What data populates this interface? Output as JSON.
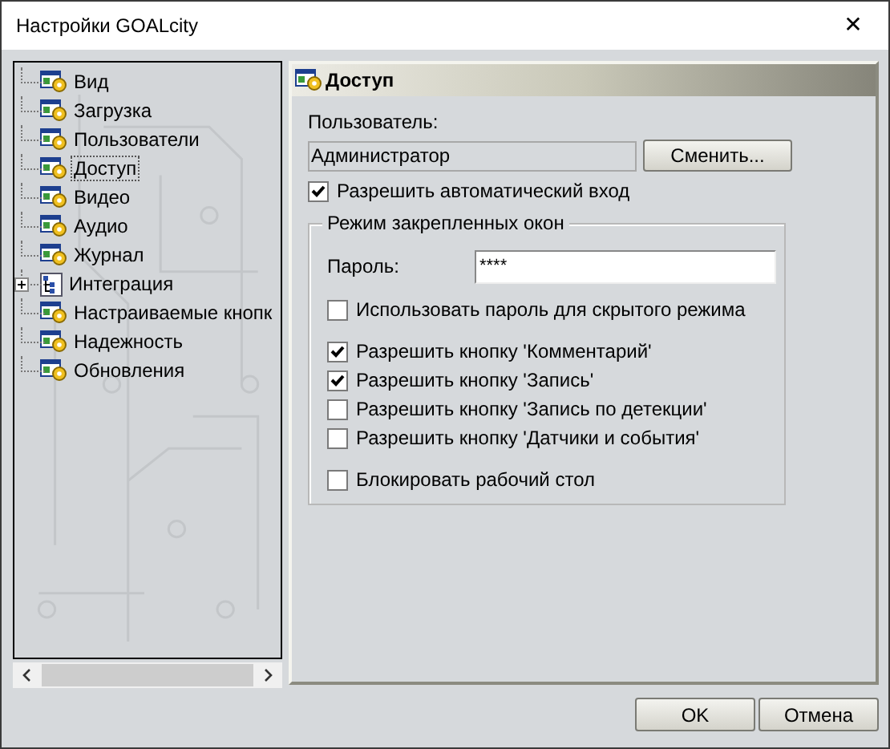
{
  "window": {
    "title": "Настройки GOALcity",
    "close": "✕"
  },
  "tree": {
    "items": [
      {
        "label": "Вид",
        "kind": "page",
        "selected": false
      },
      {
        "label": "Загрузка",
        "kind": "page",
        "selected": false
      },
      {
        "label": "Пользователи",
        "kind": "page",
        "selected": false
      },
      {
        "label": "Доступ",
        "kind": "page",
        "selected": true
      },
      {
        "label": "Видео",
        "kind": "page",
        "selected": false
      },
      {
        "label": "Аудио",
        "kind": "page",
        "selected": false
      },
      {
        "label": "Журнал",
        "kind": "page",
        "selected": false
      },
      {
        "label": "Интеграция",
        "kind": "group",
        "selected": false,
        "expanded": false
      },
      {
        "label": "Настраиваемые кнопк",
        "kind": "page",
        "selected": false
      },
      {
        "label": "Надежность",
        "kind": "page",
        "selected": false
      },
      {
        "label": "Обновления",
        "kind": "page",
        "selected": false
      }
    ]
  },
  "panel": {
    "title": "Доступ",
    "user_label": "Пользователь:",
    "user_value": "Администратор",
    "change_button": "Сменить...",
    "auto_login": {
      "label": "Разрешить автоматический вход",
      "checked": true
    },
    "group": {
      "title": "Режим закрепленных окон",
      "password_label": "Пароль:",
      "password_value": "****",
      "option_groups": [
        [
          {
            "label": "Использовать пароль для скрытого режима",
            "checked": false
          }
        ],
        [
          {
            "label": "Разрешить кнопку 'Комментарий'",
            "checked": true
          },
          {
            "label": "Разрешить кнопку 'Запись'",
            "checked": true
          },
          {
            "label": "Разрешить кнопку 'Запись по детекции'",
            "checked": false
          },
          {
            "label": "Разрешить кнопку 'Датчики и события'",
            "checked": false
          }
        ],
        [
          {
            "label": "Блокировать рабочий стол",
            "checked": false
          }
        ]
      ]
    }
  },
  "buttons": [
    "OK",
    "Отмена"
  ]
}
